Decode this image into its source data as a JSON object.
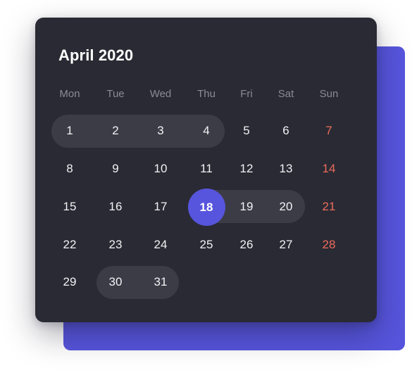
{
  "calendar": {
    "title": "April 2020",
    "weekdays": [
      "Mon",
      "Tue",
      "Wed",
      "Thu",
      "Fri",
      "Sat",
      "Sun"
    ],
    "weeks": [
      [
        "1",
        "2",
        "3",
        "4",
        "5",
        "6",
        "7"
      ],
      [
        "8",
        "9",
        "10",
        "11",
        "12",
        "13",
        "14"
      ],
      [
        "15",
        "16",
        "17",
        "18",
        "19",
        "20",
        "21"
      ],
      [
        "22",
        "23",
        "24",
        "25",
        "26",
        "27",
        "28"
      ],
      [
        "29",
        "30",
        "31"
      ]
    ],
    "selected_day": "18",
    "highlighted_ranges": [
      [
        "1",
        "4"
      ],
      [
        "18",
        "20"
      ],
      [
        "30",
        "31"
      ]
    ],
    "colors": {
      "accent": "#5755dd",
      "panel": "#2a2a34",
      "range_highlight": "#3c3c47",
      "sunday_text": "#ec6b5c",
      "day_text": "#f1f1f4",
      "weekday_text": "#8b8b96"
    }
  }
}
